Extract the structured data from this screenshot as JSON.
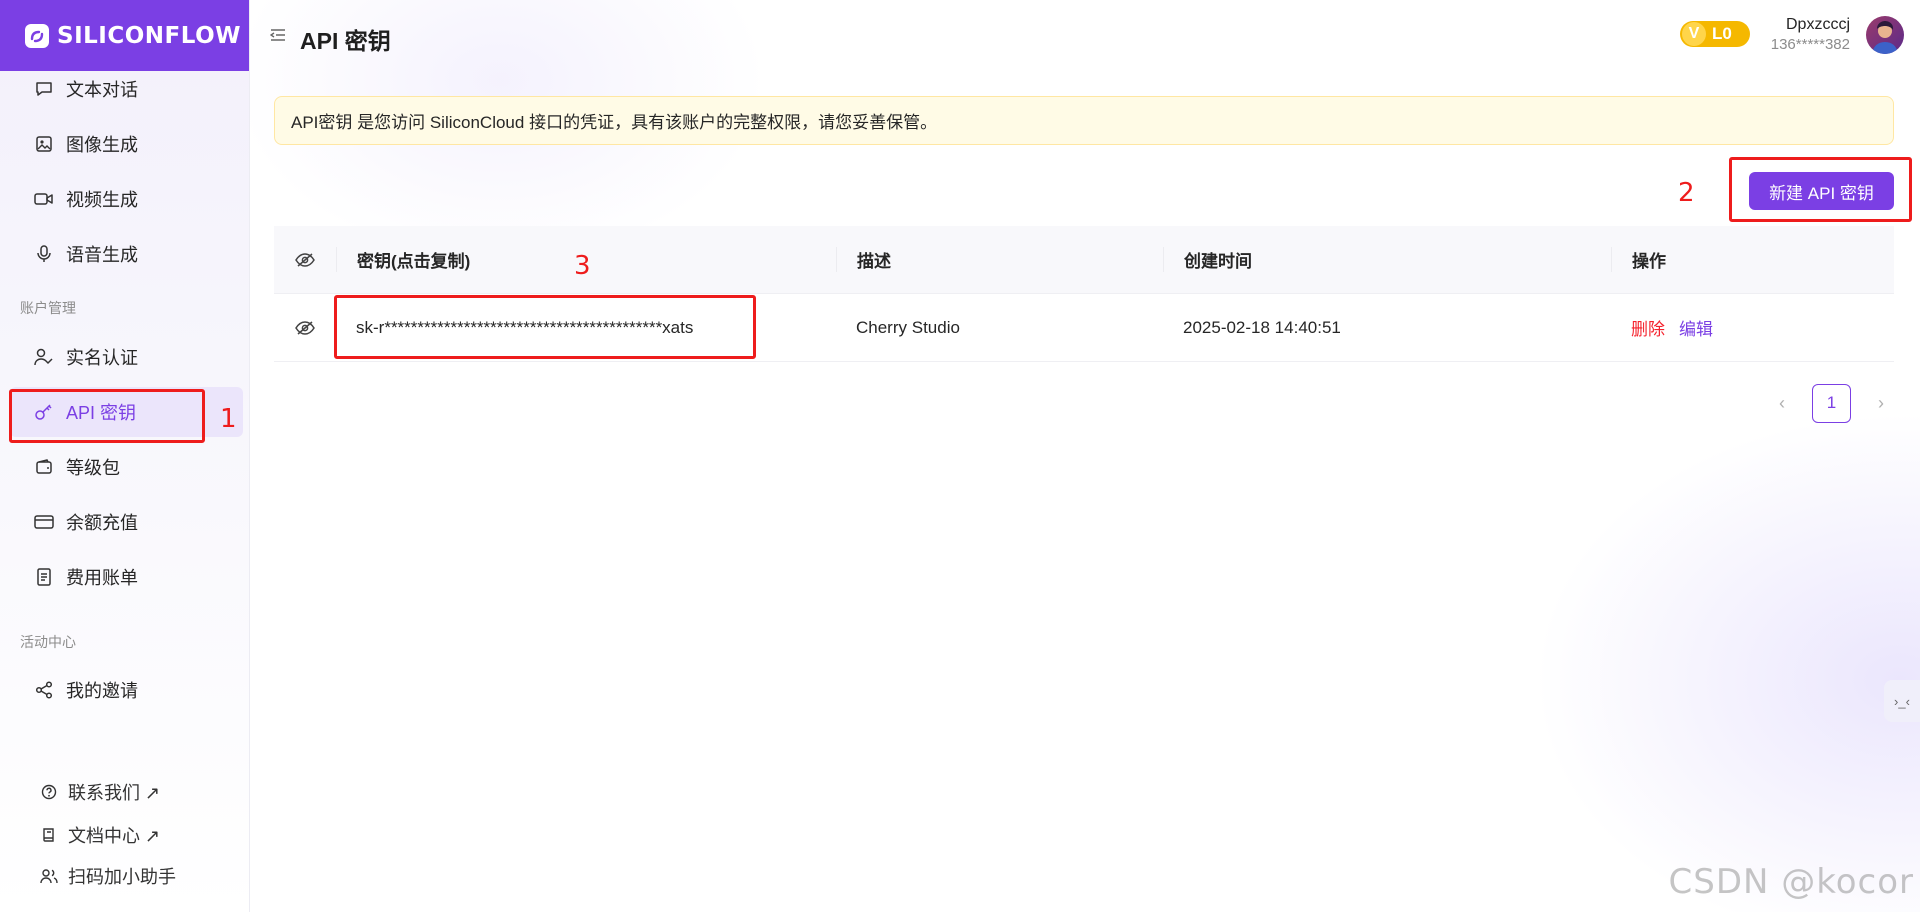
{
  "brand": {
    "logo_text": "SILICONFLOW"
  },
  "sidebar": {
    "items": [
      {
        "label": "文本对话"
      },
      {
        "label": "图像生成"
      },
      {
        "label": "视频生成"
      },
      {
        "label": "语音生成"
      }
    ],
    "account_section": {
      "title": "账户管理",
      "items": [
        {
          "label": "实名认证"
        },
        {
          "label": "API 密钥",
          "active": true
        },
        {
          "label": "等级包"
        },
        {
          "label": "余额充值"
        },
        {
          "label": "费用账单"
        }
      ]
    },
    "activity_section": {
      "title": "活动中心",
      "items": [
        {
          "label": "我的邀请"
        }
      ]
    },
    "footer": [
      {
        "label": "联系我们 ↗"
      },
      {
        "label": "文档中心 ↗"
      },
      {
        "label": "扫码加小助手"
      }
    ]
  },
  "header": {
    "title": "API 密钥",
    "level": "L0",
    "level_letter": "V",
    "user_name": "Dpxzcccj",
    "user_phone": "136*****382"
  },
  "notice": "API密钥 是您访问 SiliconCloud 接口的凭证，具有该账户的完整权限，请您妥善保管。",
  "actions": {
    "new_key": "新建 API 密钥"
  },
  "table": {
    "columns": [
      "密钥(点击复制)",
      "描述",
      "创建时间",
      "操作"
    ],
    "rows": [
      {
        "key": "sk-r******************************************xats",
        "description": "Cherry Studio",
        "created": "2025-02-18 14:40:51",
        "delete_label": "删除",
        "edit_label": "编辑"
      }
    ]
  },
  "pagination": {
    "current": "1"
  },
  "annotations": {
    "n1": "1",
    "n2": "2",
    "n3": "3"
  },
  "watermark": "CSDN @kocor",
  "colors": {
    "accent": "#7b3fe4",
    "danger": "#f5222d",
    "annotation": "#ee1c1c",
    "badge": "#f5b800"
  }
}
